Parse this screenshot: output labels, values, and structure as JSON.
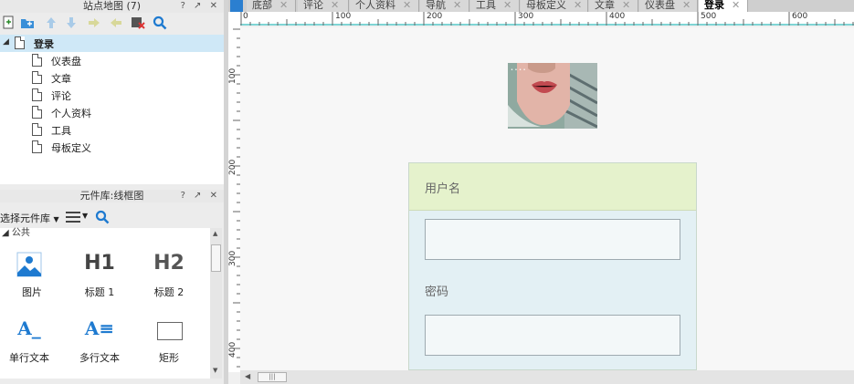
{
  "sitemap": {
    "title": "站点地图 (7)",
    "root_label": "登录",
    "pages": [
      "仪表盘",
      "文章",
      "评论",
      "个人资料",
      "工具",
      "母板定义"
    ]
  },
  "library": {
    "title": "元件库:线框图",
    "selector_label": "选择元件库",
    "group_label": "公共",
    "widgets": [
      {
        "label": "图片",
        "icon": "image-icon"
      },
      {
        "label": "标题 1",
        "icon": "heading1-icon",
        "glyph": "H1"
      },
      {
        "label": "标题 2",
        "icon": "heading2-icon",
        "glyph": "H2"
      },
      {
        "label": "单行文本",
        "icon": "single-line-text-icon",
        "glyph": "A_"
      },
      {
        "label": "多行文本",
        "icon": "multi-line-text-icon",
        "glyph": "A≡"
      },
      {
        "label": "矩形",
        "icon": "rectangle-icon"
      }
    ]
  },
  "panel_controls": "? ↗ ✕",
  "tabs": [
    {
      "label": "底部"
    },
    {
      "label": "评论"
    },
    {
      "label": "个人资料"
    },
    {
      "label": "导航"
    },
    {
      "label": "工具"
    },
    {
      "label": "母板定义"
    },
    {
      "label": "文章"
    },
    {
      "label": "仪表盘"
    },
    {
      "label": "登录",
      "active": true
    }
  ],
  "ruler": {
    "h_ticks": [
      "0",
      "100",
      "200",
      "300",
      "400",
      "500",
      "600"
    ],
    "v_ticks": [
      "100",
      "200",
      "300",
      "400"
    ]
  },
  "form": {
    "username_label": "用户名",
    "password_label": "密码",
    "username_value": "",
    "password_value": ""
  },
  "colors": {
    "accent": "#1e7ad0",
    "form_head": "#e5f2cc",
    "form_body": "#e3f0f4",
    "ruler_guide": "#7fd4d4"
  }
}
